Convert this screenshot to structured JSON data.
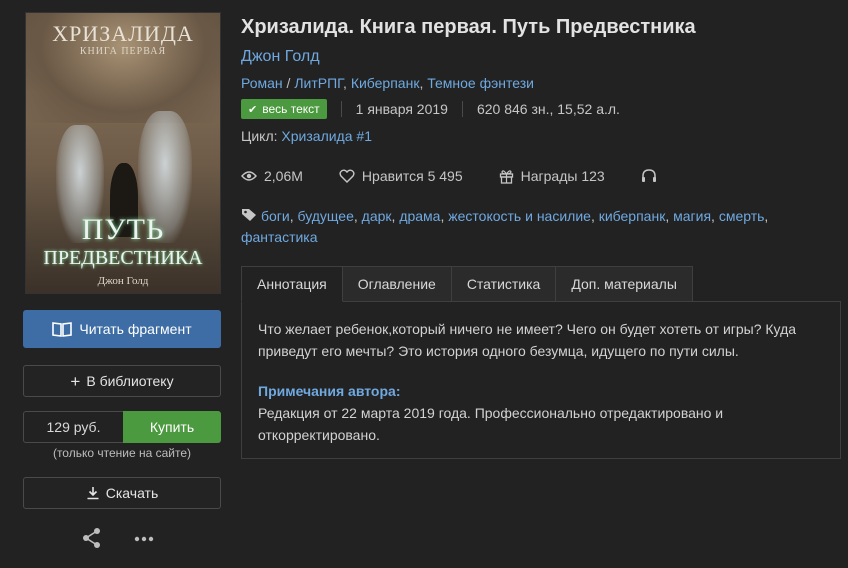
{
  "cover": {
    "series_title": "ХРИЗАЛИДА",
    "book_number": "КНИГА ПЕРВАЯ",
    "title_line1": "ПУТЬ",
    "title_line2": "ПРЕДВЕСТНИКА",
    "author": "Джон Голд"
  },
  "actions": {
    "read_fragment": "Читать фрагмент",
    "add_library": "В библиотеку",
    "price": "129 руб.",
    "buy": "Купить",
    "buy_note": "(только чтение на сайте)",
    "download": "Скачать"
  },
  "book": {
    "title": "Хризалида. Книга первая. Путь Предвестника",
    "author": "Джон Голд",
    "genres": [
      "Роман",
      "ЛитРПГ",
      "Киберпанк",
      "Темное фэнтези"
    ],
    "badge": "весь текст",
    "date": "1 января 2019",
    "size": "620 846 зн., 15,52 а.л.",
    "cycle_label": "Цикл:",
    "cycle_value": "Хризалида #1"
  },
  "stats": {
    "views": "2,06M",
    "likes_label": "Нравится",
    "likes": "5 495",
    "awards_label": "Награды",
    "awards": "123"
  },
  "tags": [
    "боги",
    "будущее",
    "дарк",
    "драма",
    "жестокость и насилие",
    "киберпанк",
    "магия",
    "смерть",
    "фантастика"
  ],
  "tabs": [
    "Аннотация",
    "Оглавление",
    "Статистика",
    "Доп. материалы"
  ],
  "annotation": {
    "text": "Что желает ребенок,который ничего не имеет? Чего он будет хотеть от игры? Куда приведут его мечты? Это история одного безумца, идущего по пути силы.",
    "notes_heading": "Примечания автора:",
    "notes_text": "Редакция от 22 марта 2019 года. Профессионально отредактировано и откорректировано."
  },
  "colors": {
    "background": "#222222",
    "link": "#6fa9e0",
    "read_button": "#3d6da4",
    "buy_button": "#4c9a3f"
  }
}
